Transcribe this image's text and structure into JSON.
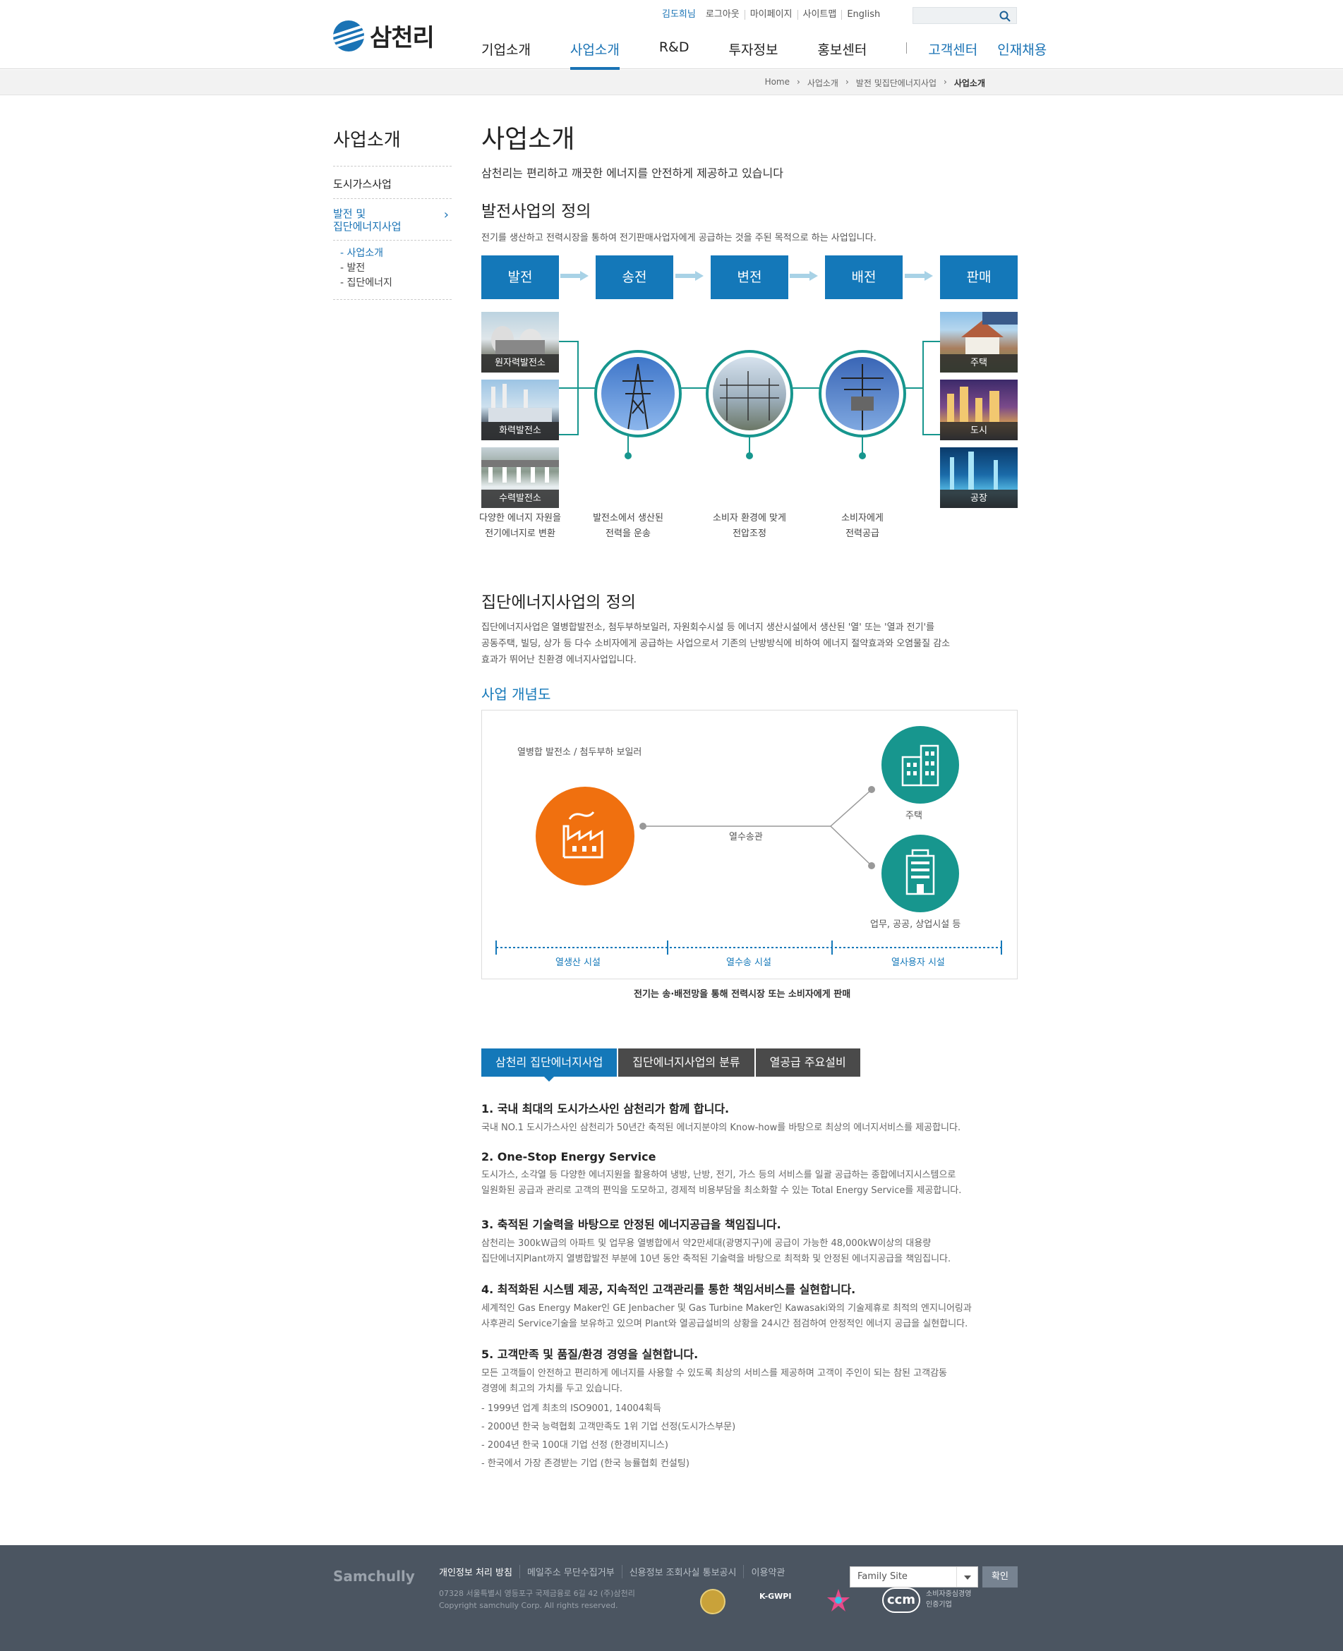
{
  "header": {
    "logo_text": "삼천리",
    "util": [
      "김도희님",
      "로그아웃",
      "마이페이지",
      "사이트맵",
      "English"
    ],
    "nav": [
      "기업소개",
      "사업소개",
      "R&D",
      "투자정보",
      "홍보센터",
      "고객센터",
      "인재채용"
    ]
  },
  "breadcrumb": [
    "Home",
    "사업소개",
    "발전 및집단에너지사업",
    "사업소개"
  ],
  "side": {
    "title": "사업소개",
    "items": [
      "도시가스사업",
      "발전 및\n집단에너지사업"
    ],
    "sub": [
      "- 사업소개",
      "- 발전",
      "- 집단에너지"
    ]
  },
  "main": {
    "title": "사업소개",
    "subtitle": "삼천리는 편리하고 깨끗한 에너지를 안전하게 제공하고 있습니다",
    "s1_title": "발전사업의 정의",
    "s1_desc": "전기를 생산하고 전력시장을 통하여 전기판매사업자에게 공급하는 것을 주된 목적으로 하는 사업입니다.",
    "steps": [
      "발전",
      "송전",
      "변전",
      "배전",
      "판매"
    ],
    "plants": [
      "원자력발전소",
      "화력발전소",
      "수력발전소"
    ],
    "uses": [
      "주택",
      "도시",
      "공장"
    ],
    "descs": [
      "다양한 에너지 자원을\n전기에너지로 변환",
      "발전소에서 생산된\n전력을 운송",
      "소비자 환경에 맞게\n전압조정",
      "소비자에게\n전력공급"
    ],
    "s2_title": "집단에너지사업의 정의",
    "s2_desc": "집단에너지사업은 열병합발전소, 첨두부하보일러, 자원회수시설 등 에너지 생산시설에서 생산된 '열' 또는 '열과 전기'를\n공동주택, 빌딩, 상가 등 다수 소비자에게 공급하는 사업으로서 기존의 난방방식에 비하여 에너지 절약효과와 오염물질 감소\n효과가 뛰어난 친환경 에너지사업입니다.",
    "concept_title": "사업 개념도",
    "concept": {
      "plant": "열병합 발전소 / 첨두부하 보일러",
      "pipe": "열수송관",
      "home": "주택",
      "biz": "업무, 공공, 상업시설 등",
      "zones": [
        "열생산 시설",
        "열수송 시설",
        "열사용자 시설"
      ],
      "note": "전기는 송·배전망을 통해 전력시장 또는 소비자에게 판매"
    },
    "tabs": [
      "삼천리 집단에너지사업",
      "집단에너지사업의 분류",
      "열공급 주요설비"
    ],
    "sections": [
      {
        "h": "1. 국내 최대의 도시가스사인 삼천리가 함께 합니다.",
        "p": "국내 NO.1 도시가스사인 삼천리가 50년간 축적된 에너지분야의 Know-how를 바탕으로 최상의 에너지서비스를 제공합니다."
      },
      {
        "h": "2. One-Stop Energy Service",
        "p": "도시가스, 소각열 등 다양한 에너지원을 활용하여 냉방, 난방, 전기, 가스 등의 서비스를 일괄 공급하는 종합에너지시스템으로\n일원화된 공급과 관리로 고객의 편익을 도모하고, 경제적 비용부담을 최소화할 수 있는 Total Energy Service를 제공합니다."
      },
      {
        "h": "3. 축적된 기술력을 바탕으로 안정된 에너지공급을 책임집니다.",
        "p": "삼천리는 300kW급의 아파트 및 업무용 열병합에서 약2만세대(광명지구)에 공급이 가능한 48,000kW이상의 대용량\n집단에너지Plant까지 열병합발전 부분에 10년 동안 축적된 기술력을 바탕으로 최적화 및 안정된 에너지공급을 책임집니다."
      },
      {
        "h": "4. 최적화된 시스템 제공, 지속적인 고객관리를 통한 책임서비스를 실현합니다.",
        "p": "세계적인 Gas Energy Maker인 GE Jenbacher 및 Gas Turbine Maker인 Kawasaki와의 기술제휴로 최적의 엔지니어링과\n사후관리 Service기술을 보유하고 있으며 Plant와 열공급설비의 상황을 24시간 점검하여 안정적인 에너지 공급을 실현합니다."
      },
      {
        "h": "5. 고객만족 및 품질/환경 경영을 실현합니다.",
        "p": "모든 고객들이 안전하고 편리하게 에너지를 사용할 수 있도록 최상의 서비스를 제공하며 고객이 주인이 되는 참된 고객감동\n경영에 최고의 가치를 두고 있습니다."
      }
    ],
    "awards": [
      "- 1999년 업계 최초의 ISO9001, 14004획득",
      "- 2000년 한국 능력협회 고객만족도 1위 기업 선정(도시가스부문)",
      "- 2004년 한국 100대 기업 선정 (한경비지니스)",
      "- 한국에서 가장 존경받는 기업 (한국 능률협회 컨설팅)"
    ]
  },
  "footer": {
    "logo": "Samchully",
    "links": [
      "개인정보 처리 방침",
      "메일주소 무단수집거부",
      "신용정보 조회사실 통보공시",
      "이용약관"
    ],
    "addr": "07328 서울특별시 영등포구 국제금융로 6길 42 (주)삼천리",
    "copy": "Copyright samchully Corp. All rights reserved.",
    "family": "Family Site",
    "ok": "확인",
    "cert1": "K-GWPI",
    "cert2": "소비자중심경영\n인증기업",
    "cert2_logo": "ccm"
  },
  "colors": {
    "primary": "#1478b9",
    "teal": "#17968e",
    "orange": "#f07010",
    "footer": "#4b5561"
  }
}
